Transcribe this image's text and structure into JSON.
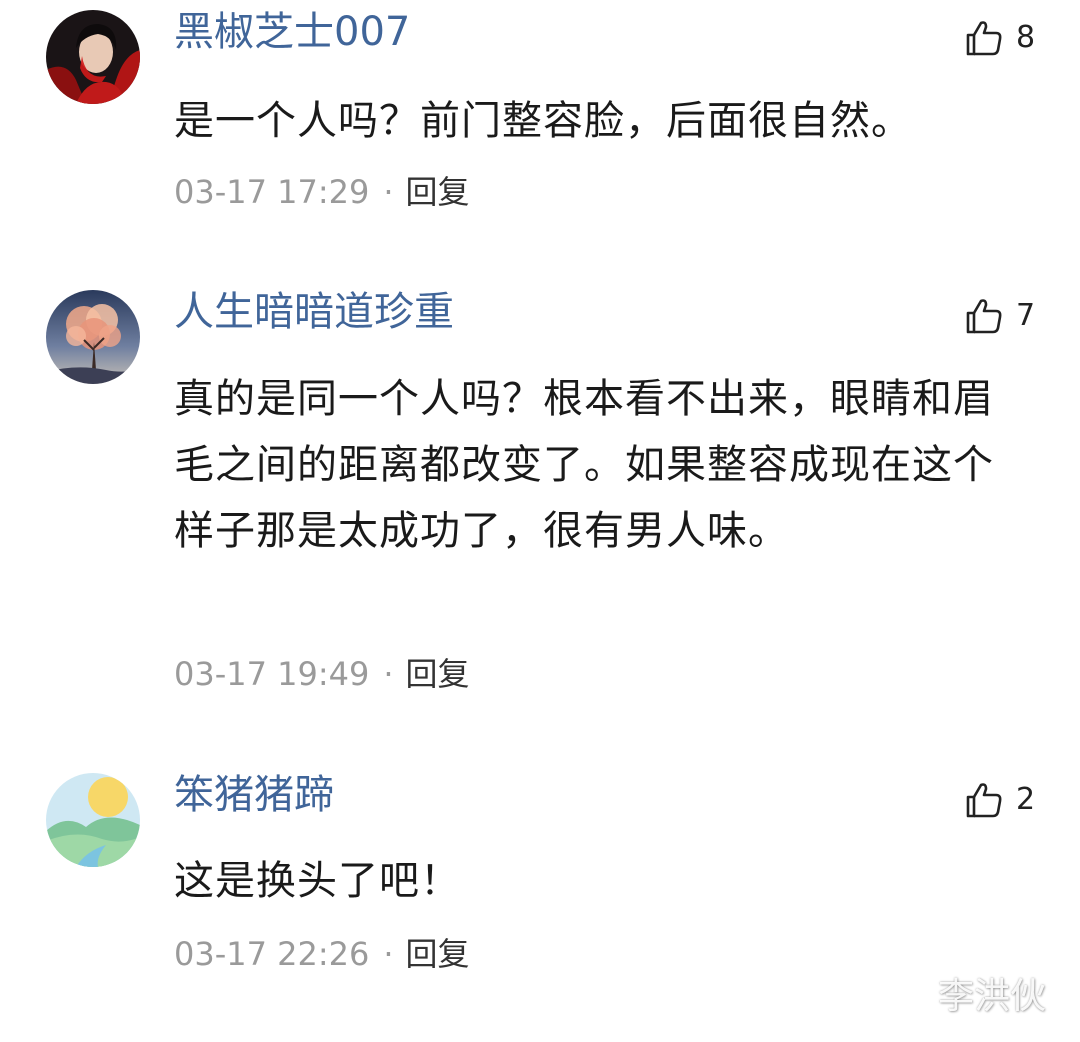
{
  "comments": [
    {
      "username": "黑椒芝士007",
      "likes": "8",
      "content": "是一个人吗？前门整容脸，后面很自然。",
      "timestamp": "03-17 17:29",
      "separator": "·",
      "reply_label": "回复",
      "avatar_icon": "person-in-red-avatar"
    },
    {
      "username": "人生暗暗道珍重",
      "likes": "7",
      "content": "真的是同一个人吗？根本看不出来，眼睛和眉毛之间的距离都改变了。如果整容成现在这个样子那是太成功了，很有男人味。",
      "timestamp": "03-17 19:49",
      "separator": "·",
      "reply_label": "回复",
      "avatar_icon": "blossom-tree-avatar"
    },
    {
      "username": "笨猪猪蹄",
      "likes": "2",
      "content": "这是换头了吧！",
      "timestamp": "03-17 22:26",
      "separator": "·",
      "reply_label": "回复",
      "avatar_icon": "landscape-sun-avatar"
    }
  ],
  "watermark": "李洪伙",
  "colors": {
    "username": "#406599",
    "content": "#1a1a1a",
    "meta": "#9a9a9a",
    "reply": "#333333"
  }
}
